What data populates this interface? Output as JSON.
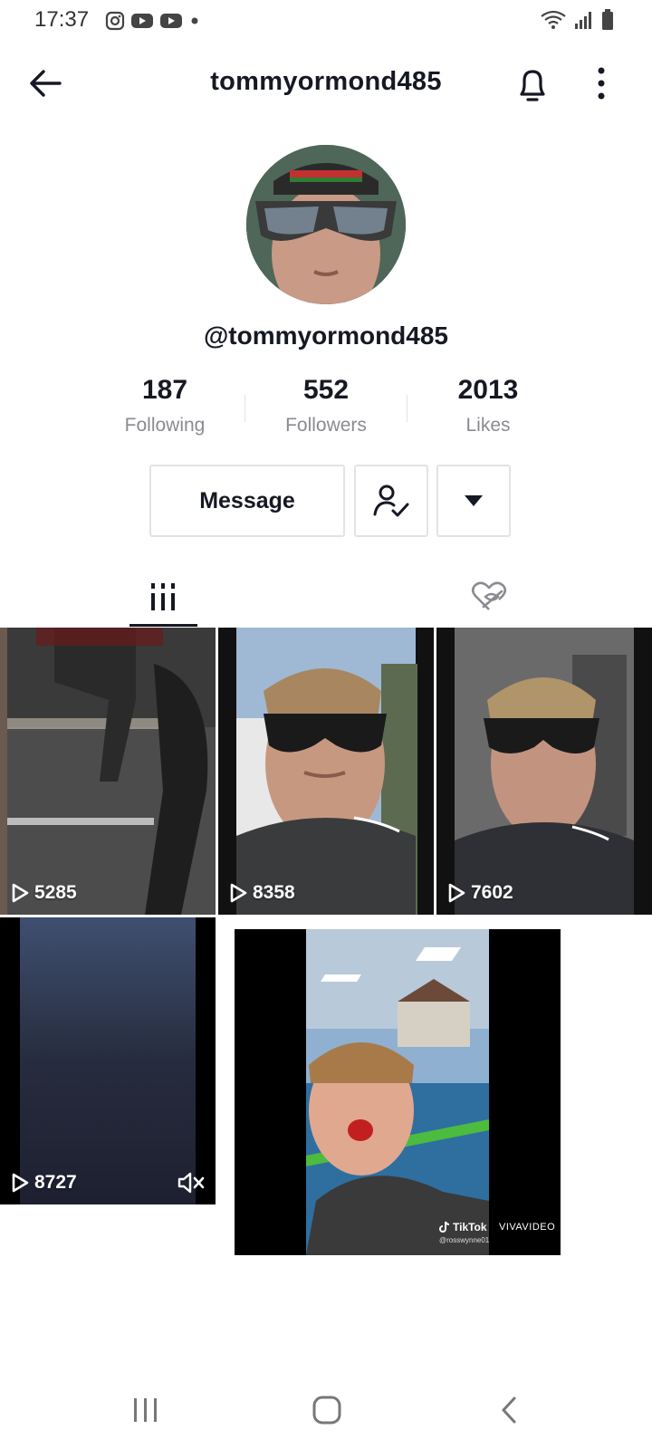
{
  "status_bar": {
    "time": "17:37"
  },
  "header": {
    "title": "tommyormond485"
  },
  "profile": {
    "handle": "@tommyormond485",
    "stats": [
      {
        "value": "187",
        "label": "Following"
      },
      {
        "value": "552",
        "label": "Followers"
      },
      {
        "value": "2013",
        "label": "Likes"
      }
    ],
    "message_label": "Message"
  },
  "videos": [
    {
      "views": "5285"
    },
    {
      "views": "8358"
    },
    {
      "views": "7602"
    },
    {
      "views": "8727"
    }
  ],
  "overlay": {
    "tiktok": "TikTok",
    "handle": "@rosswynne01",
    "vivavideo": "VIVAVIDEO"
  }
}
